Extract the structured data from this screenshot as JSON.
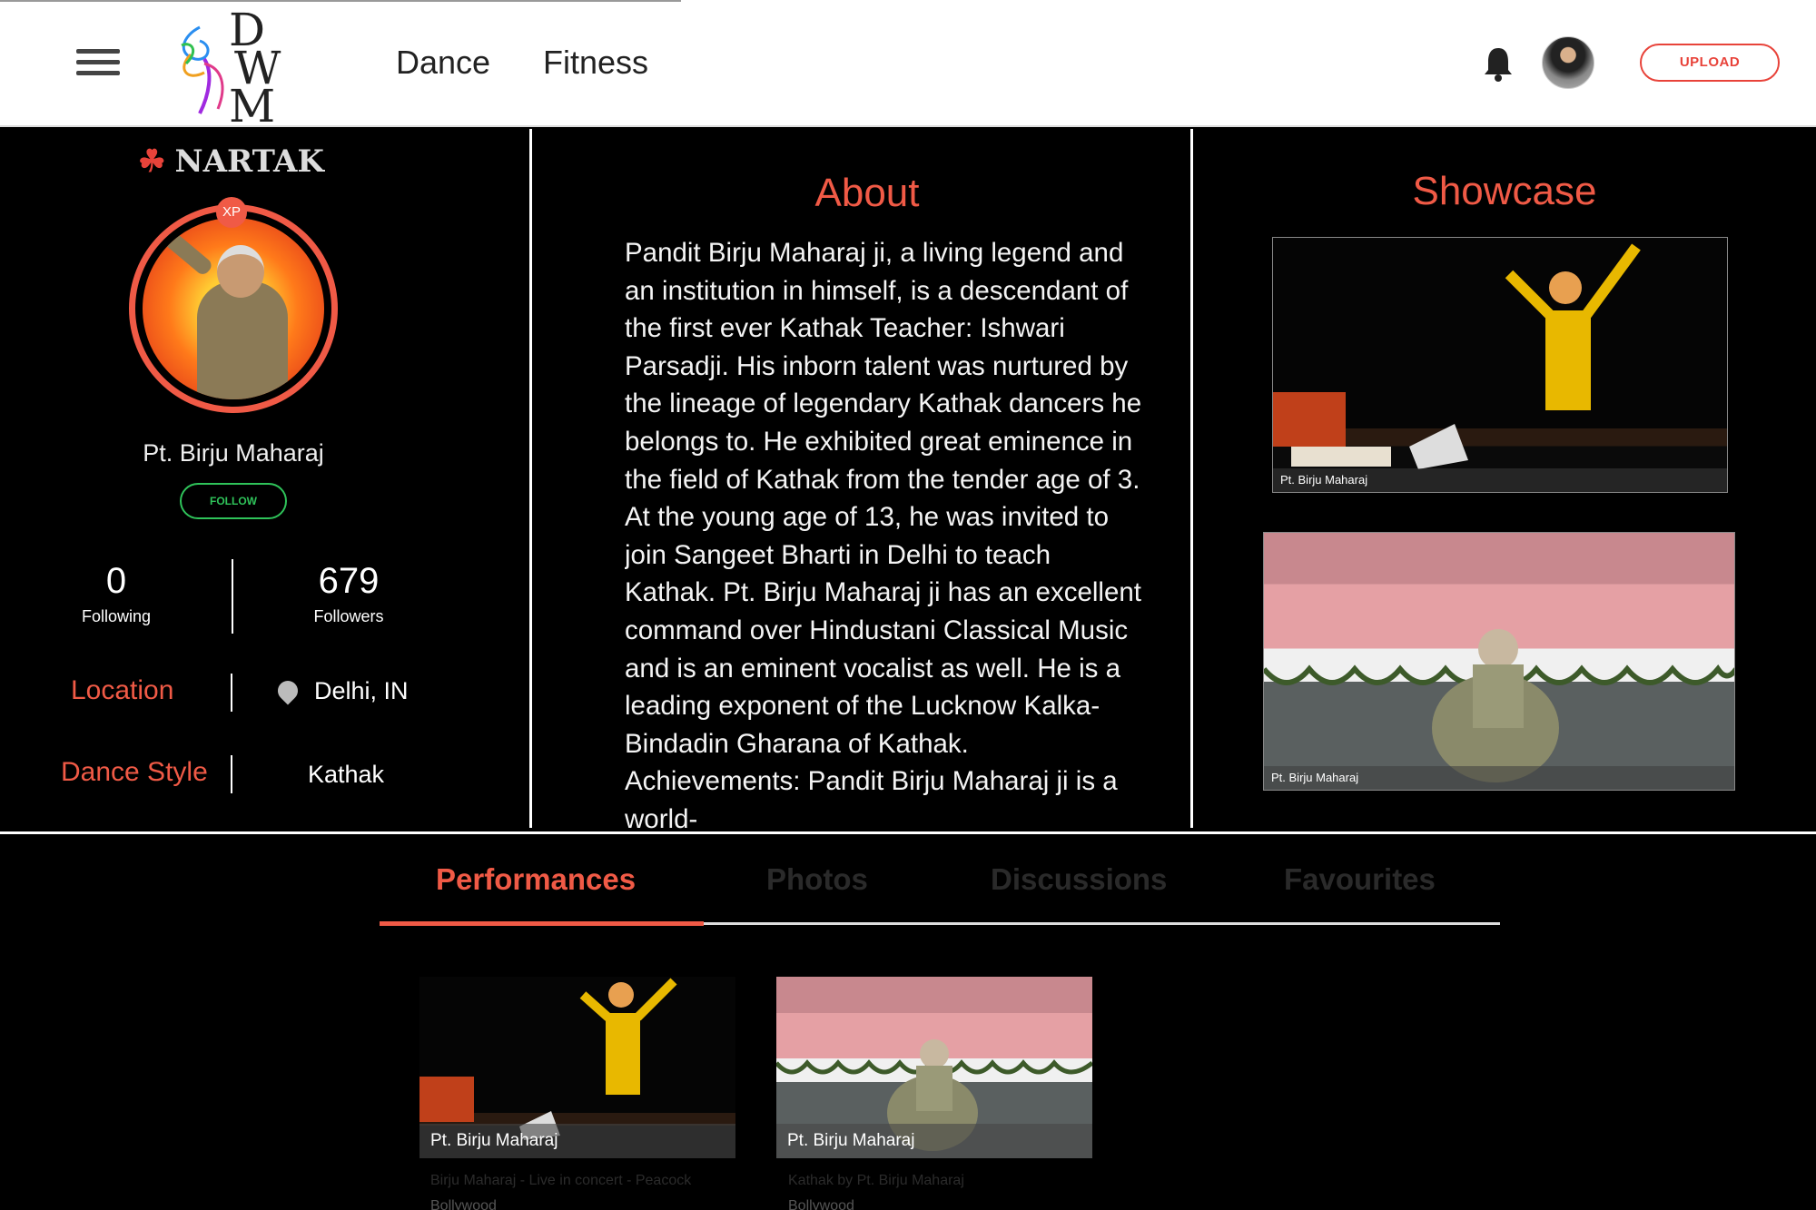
{
  "header": {
    "logo_letters": [
      "D",
      "W",
      "M"
    ],
    "nav": [
      "Dance",
      "Fitness"
    ],
    "upload_label": "UPLOAD"
  },
  "profile": {
    "badge_title": "NARTAK",
    "xp_label": "XP",
    "name": "Pt. Birju Maharaj",
    "follow_label": "FOLLOW",
    "following_count": "0",
    "following_label": "Following",
    "followers_count": "679",
    "followers_label": "Followers",
    "location_label": "Location",
    "location_value": "Delhi, IN",
    "dance_style_label": "Dance Style",
    "dance_style_value": "Kathak"
  },
  "about": {
    "title": "About",
    "text": "Pandit Birju Maharaj ji, a living legend and an institution in himself, is a descendant of the first ever Kathak Teacher: Ishwari Parsadji. His inborn talent was nurtured by the lineage of legendary Kathak dancers he belongs to. He exhibited great eminence in the field of Kathak from the tender age of 3.  At the young age of 13, he was invited to join Sangeet Bharti in Delhi to teach Kathak. Pt. Birju Maharaj ji has an excellent command over Hindustani Classical Music and is an eminent vocalist as well.  He is a leading exponent of the Lucknow Kalka-Bindadin Gharana of Kathak.   Achievements: Pandit Birju Maharaj ji is a world-"
  },
  "showcase": {
    "title": "Showcase",
    "videos": [
      {
        "caption": "Pt. Birju Maharaj"
      },
      {
        "caption": "Pt. Birju Maharaj"
      }
    ]
  },
  "tabs": [
    {
      "label": "Performances",
      "active": true
    },
    {
      "label": "Photos",
      "active": false
    },
    {
      "label": "Discussions",
      "active": false
    },
    {
      "label": "Favourites",
      "active": false
    }
  ],
  "performances": [
    {
      "caption": "Pt. Birju Maharaj",
      "description": "Birju Maharaj - Live in concert - Peacock",
      "category": "Bollywood"
    },
    {
      "caption": "Pt. Birju Maharaj",
      "description": "Kathak by Pt. Birju Maharaj",
      "category": "Bollywood"
    }
  ],
  "colors": {
    "accent": "#f05a46",
    "follow_green": "#2fc35a",
    "background": "#000000",
    "header_bg": "#ffffff"
  },
  "icons": [
    "menu-icon",
    "bell-icon",
    "location-pin-icon",
    "nartak-triskelion-icon"
  ]
}
